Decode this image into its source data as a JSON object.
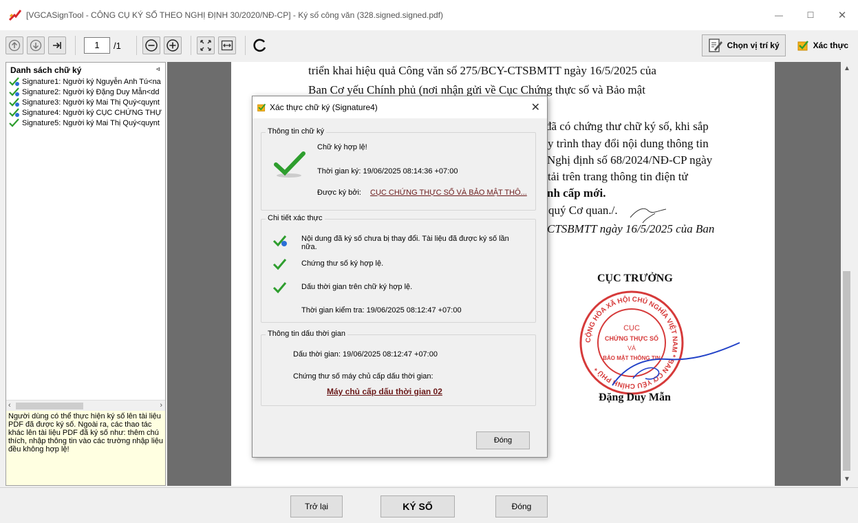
{
  "window": {
    "title": "[VGCASignTool - CÔNG CỤ KÝ SỐ THEO NGHỊ ĐỊNH 30/2020/NĐ-CP] - Ký số công văn (328.signed.signed.pdf)",
    "minimize": "—",
    "maximize": "☐",
    "close": "✕"
  },
  "toolbar": {
    "page_current": "1",
    "page_total": "/1",
    "choose_position_label": "Chọn vị trí ký",
    "verify_label": "Xác thực"
  },
  "left_panel": {
    "header": "Danh sách chữ ký",
    "collapse": "◃",
    "signatures": [
      "Signature1: Người ký Nguyễn Anh Tú<na",
      "Signature2: Người ký Đặng Duy Mẫn<dd",
      "Signature3: Người ký Mai Thị Quý<quynt",
      "Signature4: Người ký CỤC CHỨNG THỰ",
      "Signature5: Người ký Mai Thị Quý<quynt"
    ],
    "note": "Người dùng có thể thực hiện ký số lên tài liệu PDF đã được ký số. Ngoài ra, các thao tác khác lên tài liệu PDF đã ký số như: thêm chú thích, nhập thông tin vào các trường nhập liệu đều không hợp lệ!"
  },
  "document": {
    "lines": [
      "triển khai hiệu quả Công văn số 275/BCY-CTSBMTT ngày 16/5/2025 của",
      "Ban Cơ yếu Chính phủ (nơi nhận gửi về Cục Chứng thực số và Bảo mật",
      "đã có chứng thư chữ ký số, khi sắp",
      "y trình thay đổi nội dung thông tin",
      "Nghị định số 68/2024/NĐ-CP ngày",
      "tải trên trang thông tin điện tử",
      "nh cấp mới.",
      "quý Cơ quan./.",
      "CTSBMTT ngày 16/5/2025 của Ban"
    ],
    "signer_title": "CỤC TRƯỞNG",
    "signer_name": "Đặng Duy Mẫn",
    "seal_ring": "CỘNG HÒA XÃ HỘI CHỦ NGHĨA VIỆT NAM * BAN CƠ YẾU CHÍNH PHỦ *",
    "seal_lines": [
      "CỤC",
      "CHỨNG THỰC SỐ",
      "VÀ",
      "BẢO MẬT THÔNG TIN"
    ]
  },
  "dialog": {
    "title": "Xác thực chữ ký (Signature4)",
    "close": "✕",
    "sig_info": {
      "label": "Thông tin chữ ký",
      "valid": "Chữ ký hợp lệ!",
      "sign_time": "Thời gian ký: 19/06/2025 08:14:36 +07:00",
      "signed_by_label": "Được ký bởi:",
      "signed_by": "CỤC CHỨNG THỰC SỐ VÀ BẢO MẬT THÔ..."
    },
    "verify_detail": {
      "label": "Chi tiết xác thực",
      "content_ok": "Nội dung đã ký số chưa bị thay đổi. Tài liệu đã được ký số lần nữa.",
      "cert_ok": "Chứng thư số ký hợp lệ.",
      "timestamp_ok": "Dấu thời gian trên chữ ký hợp lệ.",
      "check_time": "Thời gian kiểm tra: 19/06/2025 08:12:47 +07:00"
    },
    "timestamp_info": {
      "label": "Thông tin dấu thời gian",
      "timestamp": "Dấu thời gian: 19/06/2025 08:12:47 +07:00",
      "tsa_cert_label": "Chứng thư số máy chủ cấp dấu thời gian:",
      "tsa_name": "Máy chủ cấp dấu thời gian 02"
    },
    "ok_button": "Đóng"
  },
  "bottom": {
    "back": "Trở lại",
    "sign": "KÝ SỐ",
    "close": "Đóng"
  },
  "colors": {
    "check_green": "#2e9e2e",
    "seal_red": "#d63a3a",
    "signature_blue": "#2343c8",
    "link_dark_red": "#6b1a1a",
    "note_bg": "#ffffe1"
  }
}
